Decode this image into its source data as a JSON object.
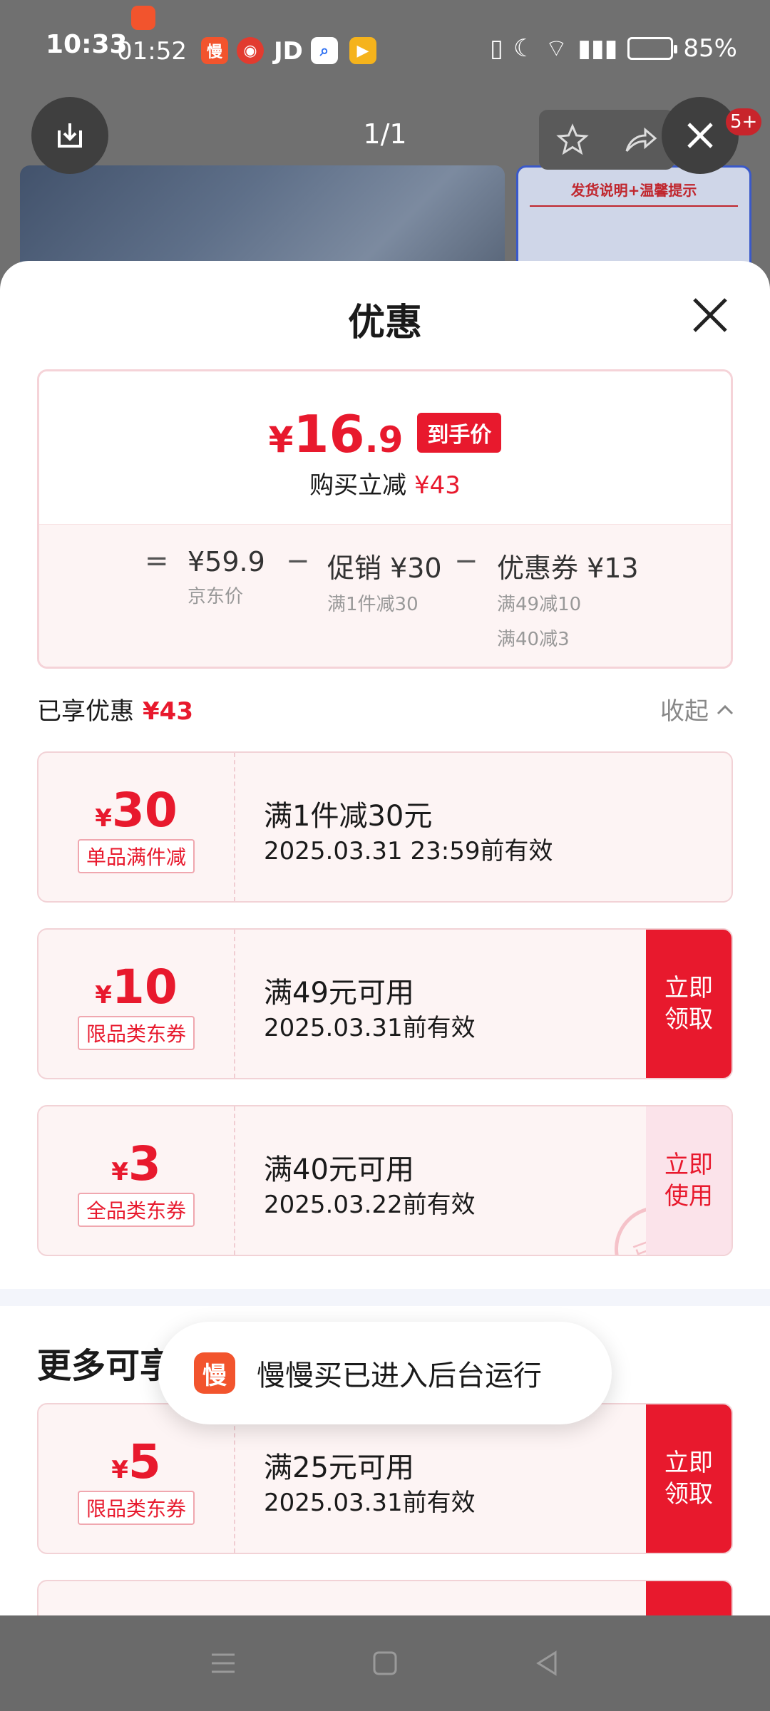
{
  "status_bar": {
    "time": "10:33",
    "time_overlay": "01:52",
    "jd_label": "JD",
    "battery": "85%",
    "app_icon_man": "慢"
  },
  "viewer": {
    "counter": "1/1",
    "badge": "5+",
    "preview_title": "发货说明+温馨提示"
  },
  "sheet": {
    "title": "优惠",
    "final_price": {
      "currency": "¥",
      "integer": "16",
      "decimal": ".9",
      "tag": "到手价",
      "subtitle_prefix": "购买立减",
      "subtitle_amount": "¥43"
    },
    "formula": {
      "equals": "=",
      "jd_price": "¥59.9",
      "jd_price_label": "京东价",
      "minus1": "−",
      "promo": "促销 ¥30",
      "promo_detail": "满1件减30",
      "minus2": "−",
      "coupon": "优惠券 ¥13",
      "coupon_detail_1": "满49减10",
      "coupon_detail_2": "满40减3"
    },
    "enjoyed": {
      "label": "已享优惠",
      "amount": "¥43",
      "collapse": "收起"
    },
    "coupons": [
      {
        "currency": "¥",
        "amount": "30",
        "tag": "单品满件减",
        "title": "满1件减30元",
        "date": "2025.03.31 23:59前有效",
        "button": ""
      },
      {
        "currency": "¥",
        "amount": "10",
        "tag": "限品类东券",
        "title": "满49元可用",
        "date": "2025.03.31前有效",
        "button": "立即\n领取"
      },
      {
        "currency": "¥",
        "amount": "3",
        "tag": "全品类东券",
        "title": "满40元可用",
        "date": "2025.03.22前有效",
        "button": "立即\n使用",
        "stamp": "已领"
      }
    ],
    "more_title": "更多可享",
    "more_coupons": [
      {
        "currency": "¥",
        "amount": "5",
        "tag": "限品类东券",
        "title": "满25元可用",
        "date": "2025.03.31前有效",
        "button": "立即\n领取"
      }
    ]
  },
  "toast": {
    "icon": "慢",
    "text": "慢慢买已进入后台运行"
  },
  "colors": {
    "accent": "#e8192d",
    "card_bg": "#fdf4f4"
  }
}
